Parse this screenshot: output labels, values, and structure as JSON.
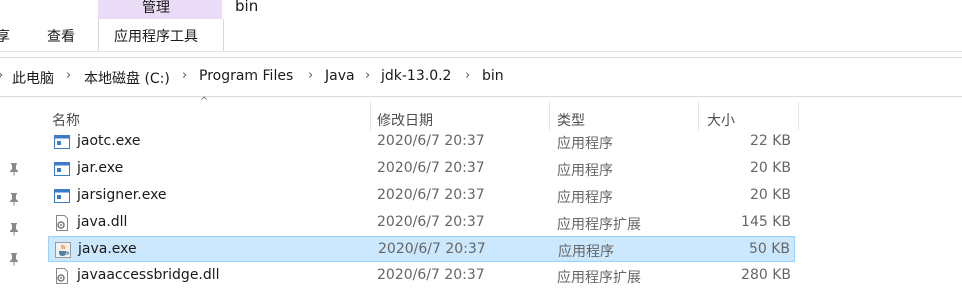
{
  "ribbon": {
    "manage_label": "管理",
    "folder_title": "bin",
    "tabs": [
      "享",
      "查看",
      "应用程序工具"
    ]
  },
  "address": {
    "crumbs": [
      "此电脑",
      "本地磁盘 (C:)",
      "Program Files",
      "Java",
      "jdk-13.0.2",
      "bin"
    ]
  },
  "columns": {
    "name": "名称",
    "date": "修改日期",
    "type": "类型",
    "size": "大小"
  },
  "files": [
    {
      "name": "jaotc.exe",
      "date": "2020/6/7 20:37",
      "type": "应用程序",
      "size": "22 KB",
      "icon": "exe-window-icon"
    },
    {
      "name": "jar.exe",
      "date": "2020/6/7 20:37",
      "type": "应用程序",
      "size": "20 KB",
      "icon": "exe-window-icon"
    },
    {
      "name": "jarsigner.exe",
      "date": "2020/6/7 20:37",
      "type": "应用程序",
      "size": "20 KB",
      "icon": "exe-window-icon"
    },
    {
      "name": "java.dll",
      "date": "2020/6/7 20:37",
      "type": "应用程序扩展",
      "size": "145 KB",
      "icon": "dll-gear-icon"
    },
    {
      "name": "java.exe",
      "date": "2020/6/7 20:37",
      "type": "应用程序",
      "size": "50 KB",
      "icon": "java-cup-icon",
      "selected": true
    },
    {
      "name": "javaaccessbridge.dll",
      "date": "2020/6/7 20:37",
      "type": "应用程序扩展",
      "size": "280 KB",
      "icon": "dll-gear-icon"
    }
  ],
  "colors": {
    "selection_bg": "#cce8ff",
    "selection_border": "#99d1ff",
    "manage_tab_bg": "#eadcf7"
  }
}
